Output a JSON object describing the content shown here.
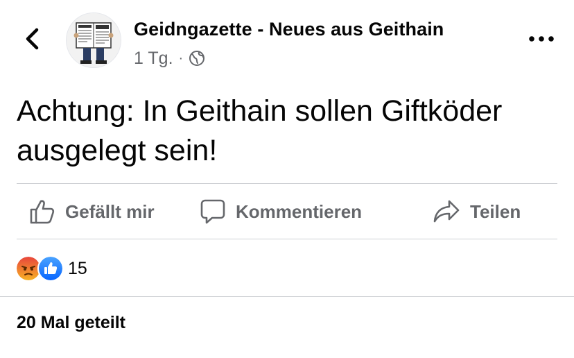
{
  "post": {
    "page_name": "Geidngazette - Neues aus Geithain",
    "time": "1 Tg.",
    "separator": "·",
    "audience_icon": "globe-icon",
    "text": "Achtung: In Geithain sollen Giftköder ausgelegt sein!"
  },
  "actions": {
    "like_label": "Gefällt mir",
    "comment_label": "Kommentieren",
    "share_label": "Teilen"
  },
  "reactions": {
    "icons": [
      "angry-reaction-icon",
      "like-reaction-icon"
    ],
    "count": "15"
  },
  "shares": {
    "label": "20 Mal geteilt"
  },
  "colors": {
    "text": "#050505",
    "secondary": "#65676b",
    "divider": "#ced0d4",
    "like_blue": "#1877f2",
    "angry_orange": "#f07a1a"
  }
}
